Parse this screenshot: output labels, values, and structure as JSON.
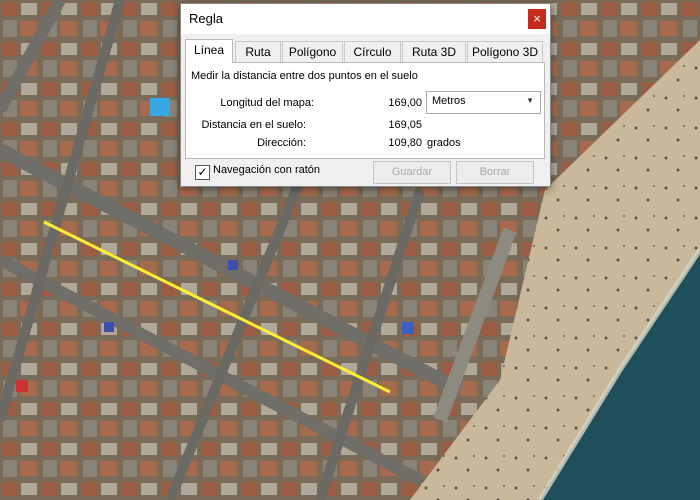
{
  "window": {
    "title": "Regla",
    "close_icon": "×"
  },
  "tabs": [
    {
      "label": "Línea",
      "active": true
    },
    {
      "label": "Ruta",
      "active": false
    },
    {
      "label": "Polígono",
      "active": false
    },
    {
      "label": "Círculo",
      "active": false
    },
    {
      "label": "Ruta 3D",
      "active": false
    },
    {
      "label": "Polígono 3D",
      "active": false
    }
  ],
  "panel": {
    "description": "Medir la distancia entre dos puntos en el suelo",
    "map_length_label": "Longitud del mapa:",
    "map_length_value": "169,00",
    "unit_selected": "Metros",
    "ground_distance_label": "Distancia en el suelo:",
    "ground_distance_value": "169,05",
    "direction_label": "Dirección:",
    "direction_value": "109,80",
    "direction_unit": "grados"
  },
  "footer": {
    "mouse_nav_label": "Navegación con ratón",
    "mouse_nav_checked": true,
    "check_mark": "✓",
    "save_label": "Guardar",
    "clear_label": "Borrar"
  },
  "colors": {
    "measure_line": "#ffee33",
    "close_button": "#c42b1c",
    "sea": "#1f4f5a",
    "sand": "#c5b596"
  }
}
